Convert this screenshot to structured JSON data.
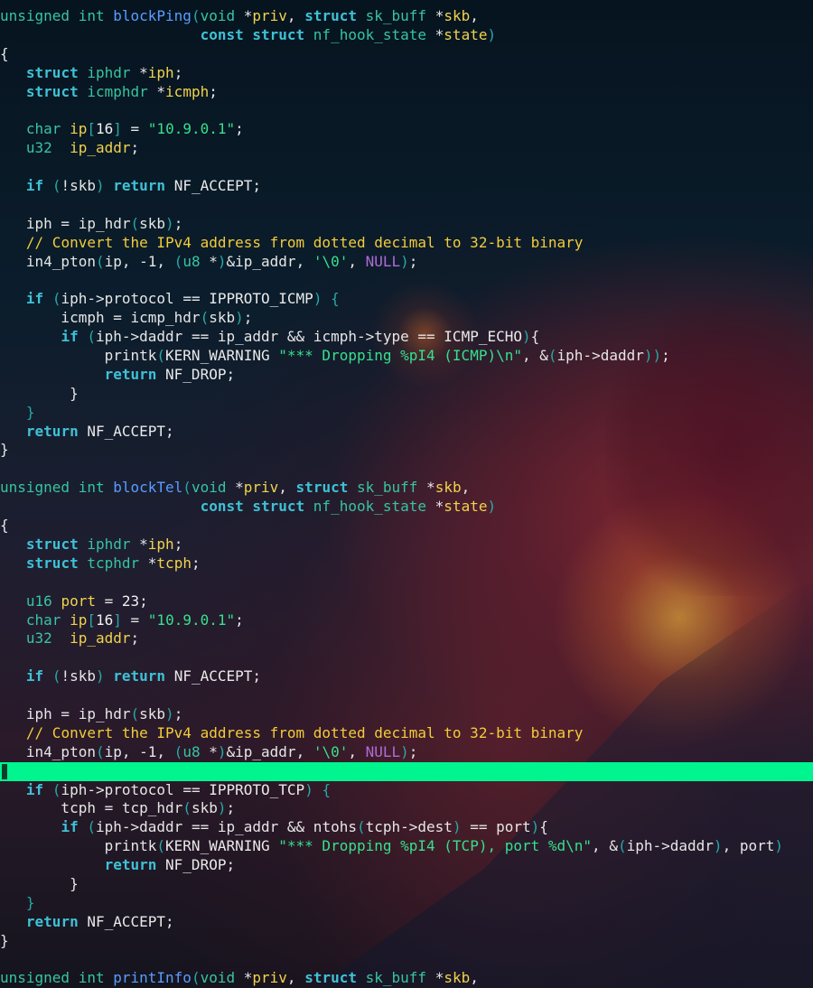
{
  "editor": {
    "theme": {
      "cursorline_color": "#00f58f",
      "keyword_color": "#3fc1d6",
      "function_color": "#5a9cff",
      "string_color": "#37e08d",
      "comment_color": "#f2cc3a",
      "null_color": "#b06cd9"
    },
    "cursor_line_index": 40,
    "lines": [
      [
        [
          "ty",
          "unsigned int "
        ],
        [
          "fn",
          "blockPing"
        ],
        [
          "par",
          "("
        ],
        [
          "ty",
          "void "
        ],
        [
          "tx",
          "*"
        ],
        [
          "id",
          "priv"
        ],
        [
          "tx",
          ", "
        ],
        [
          "kw",
          "struct "
        ],
        [
          "ty",
          "sk_buff "
        ],
        [
          "tx",
          "*"
        ],
        [
          "id",
          "skb"
        ],
        [
          "tx",
          ","
        ]
      ],
      [
        [
          "tx",
          "                       "
        ],
        [
          "kw",
          "const struct "
        ],
        [
          "ty",
          "nf_hook_state "
        ],
        [
          "tx",
          "*"
        ],
        [
          "id",
          "state"
        ],
        [
          "par",
          ")"
        ]
      ],
      [
        [
          "tx",
          "{"
        ]
      ],
      [
        [
          "tx",
          "   "
        ],
        [
          "kw",
          "struct "
        ],
        [
          "ty",
          "iphdr "
        ],
        [
          "tx",
          "*"
        ],
        [
          "id",
          "iph"
        ],
        [
          "tx",
          ";"
        ]
      ],
      [
        [
          "tx",
          "   "
        ],
        [
          "kw",
          "struct "
        ],
        [
          "ty",
          "icmphdr "
        ],
        [
          "tx",
          "*"
        ],
        [
          "id",
          "icmph"
        ],
        [
          "tx",
          ";"
        ]
      ],
      [],
      [
        [
          "tx",
          "   "
        ],
        [
          "ty",
          "char "
        ],
        [
          "id",
          "ip"
        ],
        [
          "par",
          "["
        ],
        [
          "num",
          "16"
        ],
        [
          "par",
          "]"
        ],
        [
          "tx",
          " = "
        ],
        [
          "str",
          "\"10.9.0.1\""
        ],
        [
          "tx",
          ";"
        ]
      ],
      [
        [
          "tx",
          "   "
        ],
        [
          "ty",
          "u32  "
        ],
        [
          "id",
          "ip_addr"
        ],
        [
          "tx",
          ";"
        ]
      ],
      [],
      [
        [
          "tx",
          "   "
        ],
        [
          "kw",
          "if "
        ],
        [
          "par",
          "("
        ],
        [
          "tx",
          "!skb"
        ],
        [
          "par",
          ")"
        ],
        [
          "tx",
          " "
        ],
        [
          "kw",
          "return "
        ],
        [
          "mac",
          "NF_ACCEPT"
        ],
        [
          "tx",
          ";"
        ]
      ],
      [],
      [
        [
          "tx",
          "   iph = ip_hdr"
        ],
        [
          "par",
          "("
        ],
        [
          "tx",
          "skb"
        ],
        [
          "par",
          ")"
        ],
        [
          "tx",
          ";"
        ]
      ],
      [
        [
          "tx",
          "   "
        ],
        [
          "cm",
          "// Convert the IPv4 address from dotted decimal to 32-bit binary"
        ]
      ],
      [
        [
          "tx",
          "   in4_pton"
        ],
        [
          "par",
          "("
        ],
        [
          "tx",
          "ip, -1, "
        ],
        [
          "par",
          "("
        ],
        [
          "ty",
          "u8 "
        ],
        [
          "tx",
          "*"
        ],
        [
          "par",
          ")"
        ],
        [
          "tx",
          "&ip_addr, "
        ],
        [
          "str",
          "'\\0'"
        ],
        [
          "tx",
          ", "
        ],
        [
          "nul",
          "NULL"
        ],
        [
          "par",
          ")"
        ],
        [
          "tx",
          ";"
        ]
      ],
      [],
      [
        [
          "tx",
          "   "
        ],
        [
          "kw",
          "if "
        ],
        [
          "par",
          "("
        ],
        [
          "tx",
          "iph->protocol == "
        ],
        [
          "mac",
          "IPPROTO_ICMP"
        ],
        [
          "par",
          ")"
        ],
        [
          "tx",
          " "
        ],
        [
          "par",
          "{"
        ]
      ],
      [
        [
          "tx",
          "       icmph = icmp_hdr"
        ],
        [
          "par",
          "("
        ],
        [
          "tx",
          "skb"
        ],
        [
          "par",
          ")"
        ],
        [
          "tx",
          ";"
        ]
      ],
      [
        [
          "tx",
          "       "
        ],
        [
          "kw",
          "if "
        ],
        [
          "par",
          "("
        ],
        [
          "tx",
          "iph->daddr == ip_addr && icmph->type == "
        ],
        [
          "mac",
          "ICMP_ECHO"
        ],
        [
          "par",
          ")"
        ],
        [
          "tx",
          "{"
        ]
      ],
      [
        [
          "tx",
          "            printk"
        ],
        [
          "par",
          "("
        ],
        [
          "mac",
          "KERN_WARNING "
        ],
        [
          "str",
          "\"*** Dropping %pI4 (ICMP)\\n\""
        ],
        [
          "tx",
          ", &"
        ],
        [
          "par",
          "("
        ],
        [
          "tx",
          "iph->daddr"
        ],
        [
          "par",
          "))"
        ],
        [
          "tx",
          ";"
        ]
      ],
      [
        [
          "tx",
          "            "
        ],
        [
          "kw",
          "return "
        ],
        [
          "mac",
          "NF_DROP"
        ],
        [
          "tx",
          ";"
        ]
      ],
      [
        [
          "tx",
          "        }"
        ]
      ],
      [
        [
          "tx",
          "   "
        ],
        [
          "par",
          "}"
        ]
      ],
      [
        [
          "tx",
          "   "
        ],
        [
          "kw",
          "return "
        ],
        [
          "mac",
          "NF_ACCEPT"
        ],
        [
          "tx",
          ";"
        ]
      ],
      [
        [
          "tx",
          "}"
        ]
      ],
      [],
      [
        [
          "ty",
          "unsigned int "
        ],
        [
          "fn",
          "blockTel"
        ],
        [
          "par",
          "("
        ],
        [
          "ty",
          "void "
        ],
        [
          "tx",
          "*"
        ],
        [
          "id",
          "priv"
        ],
        [
          "tx",
          ", "
        ],
        [
          "kw",
          "struct "
        ],
        [
          "ty",
          "sk_buff "
        ],
        [
          "tx",
          "*"
        ],
        [
          "id",
          "skb"
        ],
        [
          "tx",
          ","
        ]
      ],
      [
        [
          "tx",
          "                       "
        ],
        [
          "kw",
          "const struct "
        ],
        [
          "ty",
          "nf_hook_state "
        ],
        [
          "tx",
          "*"
        ],
        [
          "id",
          "state"
        ],
        [
          "par",
          ")"
        ]
      ],
      [
        [
          "tx",
          "{"
        ]
      ],
      [
        [
          "tx",
          "   "
        ],
        [
          "kw",
          "struct "
        ],
        [
          "ty",
          "iphdr "
        ],
        [
          "tx",
          "*"
        ],
        [
          "id",
          "iph"
        ],
        [
          "tx",
          ";"
        ]
      ],
      [
        [
          "tx",
          "   "
        ],
        [
          "kw",
          "struct "
        ],
        [
          "ty",
          "tcphdr "
        ],
        [
          "tx",
          "*"
        ],
        [
          "id",
          "tcph"
        ],
        [
          "tx",
          ";"
        ]
      ],
      [],
      [
        [
          "tx",
          "   "
        ],
        [
          "ty",
          "u16 "
        ],
        [
          "id",
          "port"
        ],
        [
          "tx",
          " = "
        ],
        [
          "num",
          "23"
        ],
        [
          "tx",
          ";"
        ]
      ],
      [
        [
          "tx",
          "   "
        ],
        [
          "ty",
          "char "
        ],
        [
          "id",
          "ip"
        ],
        [
          "par",
          "["
        ],
        [
          "num",
          "16"
        ],
        [
          "par",
          "]"
        ],
        [
          "tx",
          " = "
        ],
        [
          "str",
          "\"10.9.0.1\""
        ],
        [
          "tx",
          ";"
        ]
      ],
      [
        [
          "tx",
          "   "
        ],
        [
          "ty",
          "u32  "
        ],
        [
          "id",
          "ip_addr"
        ],
        [
          "tx",
          ";"
        ]
      ],
      [],
      [
        [
          "tx",
          "   "
        ],
        [
          "kw",
          "if "
        ],
        [
          "par",
          "("
        ],
        [
          "tx",
          "!skb"
        ],
        [
          "par",
          ")"
        ],
        [
          "tx",
          " "
        ],
        [
          "kw",
          "return "
        ],
        [
          "mac",
          "NF_ACCEPT"
        ],
        [
          "tx",
          ";"
        ]
      ],
      [],
      [
        [
          "tx",
          "   iph = ip_hdr"
        ],
        [
          "par",
          "("
        ],
        [
          "tx",
          "skb"
        ],
        [
          "par",
          ")"
        ],
        [
          "tx",
          ";"
        ]
      ],
      [
        [
          "tx",
          "   "
        ],
        [
          "cm",
          "// Convert the IPv4 address from dotted decimal to 32-bit binary"
        ]
      ],
      [
        [
          "tx",
          "   in4_pton"
        ],
        [
          "par",
          "("
        ],
        [
          "tx",
          "ip, -1, "
        ],
        [
          "par",
          "("
        ],
        [
          "ty",
          "u8 "
        ],
        [
          "tx",
          "*"
        ],
        [
          "par",
          ")"
        ],
        [
          "tx",
          "&ip_addr, "
        ],
        [
          "str",
          "'\\0'"
        ],
        [
          "tx",
          ", "
        ],
        [
          "nul",
          "NULL"
        ],
        [
          "par",
          ")"
        ],
        [
          "tx",
          ";"
        ]
      ],
      [],
      [
        [
          "tx",
          "   "
        ],
        [
          "kw",
          "if "
        ],
        [
          "par",
          "("
        ],
        [
          "tx",
          "iph->protocol == "
        ],
        [
          "mac",
          "IPPROTO_TCP"
        ],
        [
          "par",
          ")"
        ],
        [
          "tx",
          " "
        ],
        [
          "par",
          "{"
        ]
      ],
      [
        [
          "tx",
          "       tcph = tcp_hdr"
        ],
        [
          "par",
          "("
        ],
        [
          "tx",
          "skb"
        ],
        [
          "par",
          ")"
        ],
        [
          "tx",
          ";"
        ]
      ],
      [
        [
          "tx",
          "       "
        ],
        [
          "kw",
          "if "
        ],
        [
          "par",
          "("
        ],
        [
          "tx",
          "iph->daddr == ip_addr && ntohs"
        ],
        [
          "par",
          "("
        ],
        [
          "tx",
          "tcph->dest"
        ],
        [
          "par",
          ")"
        ],
        [
          "tx",
          " == port"
        ],
        [
          "par",
          ")"
        ],
        [
          "tx",
          "{"
        ]
      ],
      [
        [
          "tx",
          "            printk"
        ],
        [
          "par",
          "("
        ],
        [
          "mac",
          "KERN_WARNING "
        ],
        [
          "str",
          "\"*** Dropping %pI4 (TCP), port %d\\n\""
        ],
        [
          "tx",
          ", &"
        ],
        [
          "par",
          "("
        ],
        [
          "tx",
          "iph->daddr"
        ],
        [
          "par",
          ")"
        ],
        [
          "tx",
          ", port"
        ],
        [
          "par",
          ")"
        ]
      ],
      [
        [
          "tx",
          "            "
        ],
        [
          "kw",
          "return "
        ],
        [
          "mac",
          "NF_DROP"
        ],
        [
          "tx",
          ";"
        ]
      ],
      [
        [
          "tx",
          "        }"
        ]
      ],
      [
        [
          "tx",
          "   "
        ],
        [
          "par",
          "}"
        ]
      ],
      [
        [
          "tx",
          "   "
        ],
        [
          "kw",
          "return "
        ],
        [
          "mac",
          "NF_ACCEPT"
        ],
        [
          "tx",
          ";"
        ]
      ],
      [
        [
          "tx",
          "}"
        ]
      ],
      [],
      [
        [
          "ty",
          "unsigned int "
        ],
        [
          "fn",
          "printInfo"
        ],
        [
          "par",
          "("
        ],
        [
          "ty",
          "void "
        ],
        [
          "tx",
          "*"
        ],
        [
          "id",
          "priv"
        ],
        [
          "tx",
          ", "
        ],
        [
          "kw",
          "struct "
        ],
        [
          "ty",
          "sk_buff "
        ],
        [
          "tx",
          "*"
        ],
        [
          "id",
          "skb"
        ],
        [
          "tx",
          ","
        ]
      ]
    ]
  }
}
